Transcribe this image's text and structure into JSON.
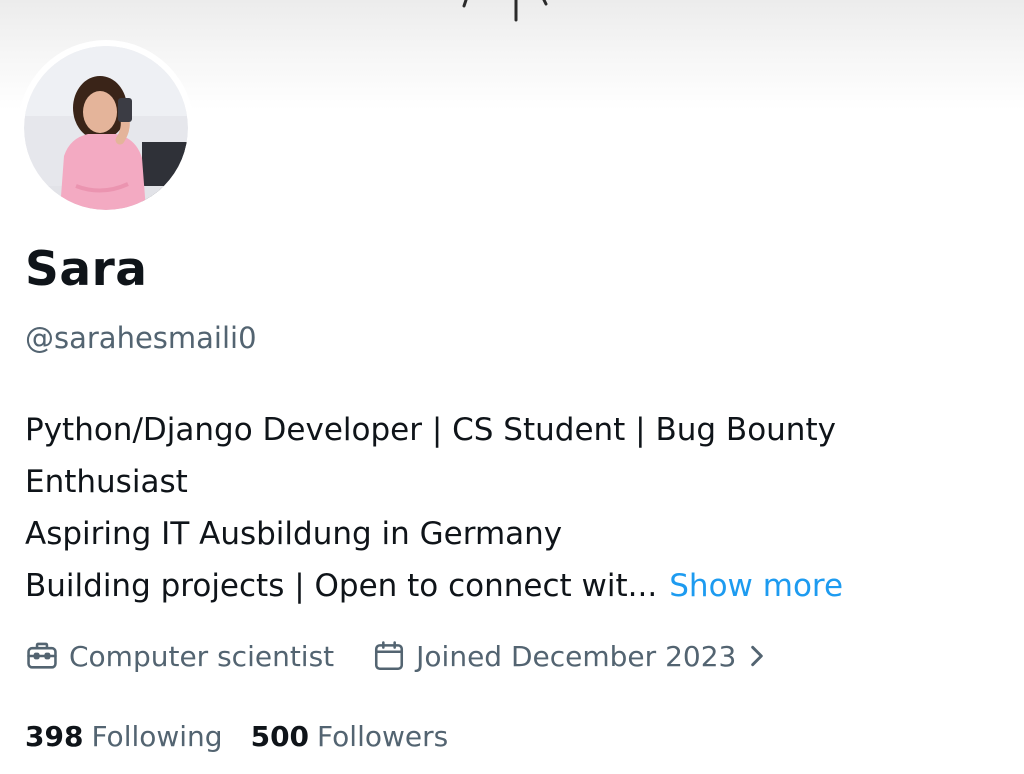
{
  "profile": {
    "display_name": "Sara",
    "handle": "@sarahesmaili0",
    "avatar_icon": "profile-photo"
  },
  "bio": {
    "lines": [
      "Python/Django Developer | CS Student | Bug Bounty",
      "Enthusiast",
      "Aspiring IT Ausbildung in Germany",
      "Building projects | Open to connect wit..."
    ],
    "show_more": "Show more"
  },
  "meta": {
    "profession": "Computer scientist",
    "profession_icon": "briefcase-icon",
    "joined": "Joined December 2023",
    "joined_icon": "calendar-icon"
  },
  "stats": {
    "following_count": "398",
    "following_label": "Following",
    "followers_count": "500",
    "followers_label": "Followers"
  },
  "colors": {
    "text_primary": "#0f1419",
    "text_secondary": "#536471",
    "link": "#1d9bf0"
  }
}
